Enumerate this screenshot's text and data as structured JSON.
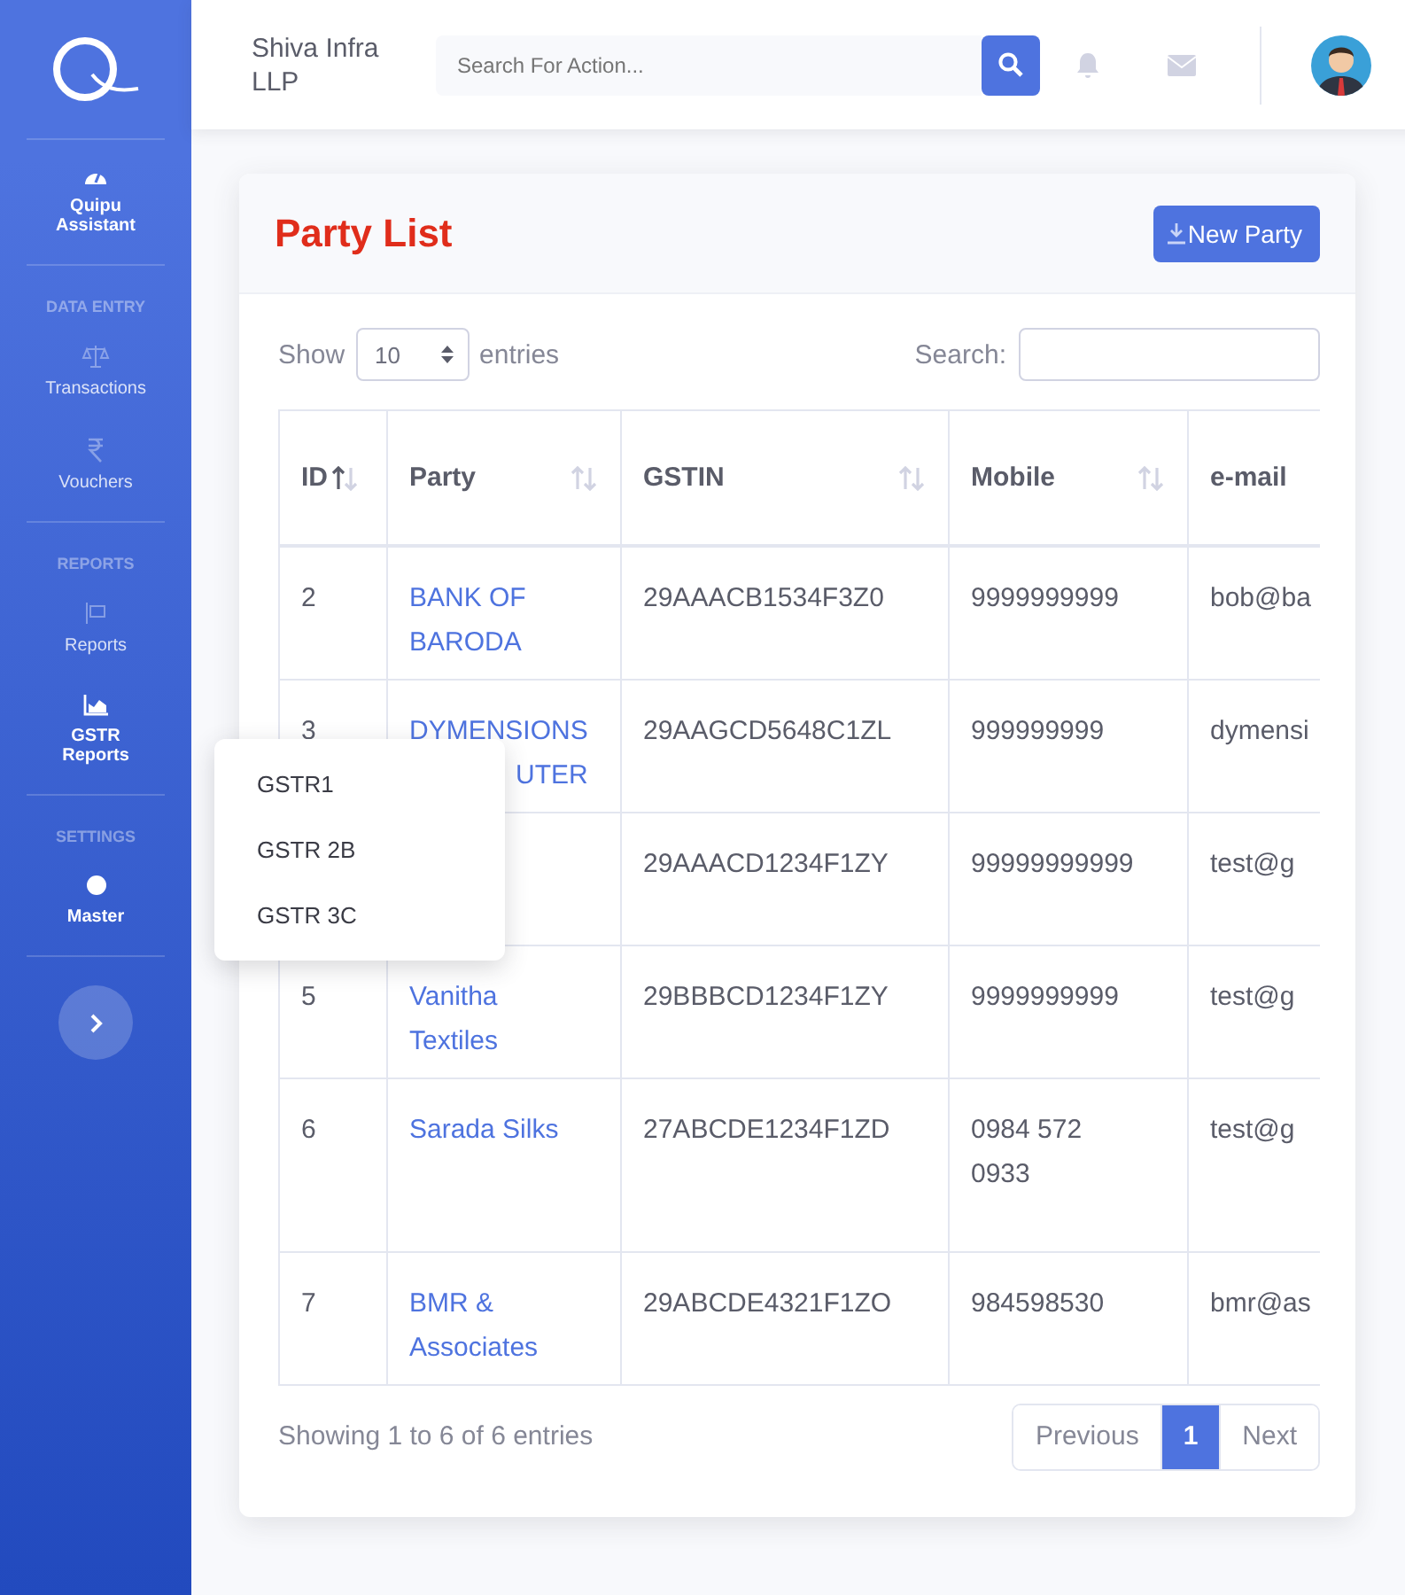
{
  "sidebar": {
    "sections": [
      {
        "items": [
          {
            "label": "Quipu Assistant",
            "active": true
          }
        ]
      },
      {
        "heading": "DATA ENTRY",
        "items": [
          {
            "label": "Transactions",
            "active": false
          },
          {
            "label": "Vouchers",
            "active": false
          }
        ]
      },
      {
        "heading": "REPORTS",
        "items": [
          {
            "label": "Reports",
            "active": false
          },
          {
            "label": "GSTR Reports",
            "active": true
          }
        ]
      },
      {
        "heading": "SETTINGS",
        "items": [
          {
            "label": "Master",
            "active": true
          }
        ]
      }
    ]
  },
  "topbar": {
    "company": "Shiva Infra LLP",
    "search": {
      "placeholder": "Search For Action..."
    }
  },
  "card": {
    "title": "Party List",
    "new_button": "New Party",
    "length": {
      "before": "Show",
      "value": "10",
      "after": "entries"
    },
    "search_label": "Search:",
    "columns": [
      {
        "label": "ID",
        "sorted": true
      },
      {
        "label": "Party",
        "sorted": false
      },
      {
        "label": "GSTIN",
        "sorted": false
      },
      {
        "label": "Mobile",
        "sorted": false
      },
      {
        "label": "e-mail"
      }
    ],
    "rows": [
      {
        "id": "2",
        "party": "BANK OF BARODA",
        "gstin": "29AAACB1534F3Z0",
        "mobile": "9999999999",
        "email": "bob@ba"
      },
      {
        "id": "3",
        "party": "DYMENSIONS",
        "party_tail": "UTER",
        "gstin": "29AAGCD5648C1ZL",
        "mobile": "999999999",
        "email": "dymensi"
      },
      {
        "gstin": "29AAACD1234F1ZY",
        "mobile": "99999999999",
        "email": "test@g"
      },
      {
        "id": "5",
        "party": "Vanitha Textiles",
        "gstin": "29BBBCD1234F1ZY",
        "mobile": "9999999999",
        "email": "test@g"
      },
      {
        "id": "6",
        "party": "Sarada Silks",
        "gstin": "27ABCDE1234F1ZD",
        "mobile": "0984 572 0933",
        "email": "test@g",
        "tall": true
      },
      {
        "id": "7",
        "party": "BMR & Associates",
        "gstin": "29ABCDE4321F1ZO",
        "mobile": "984598530",
        "email": "bmr@as"
      }
    ],
    "info": "Showing 1 to 6 of 6 entries",
    "pagination": [
      {
        "label": "Previous",
        "selected": false
      },
      {
        "label": "1",
        "selected": true
      },
      {
        "label": "Next",
        "selected": false
      }
    ]
  },
  "menu": {
    "items": [
      "GSTR1",
      "GSTR 2B",
      "GSTR 3C"
    ]
  }
}
